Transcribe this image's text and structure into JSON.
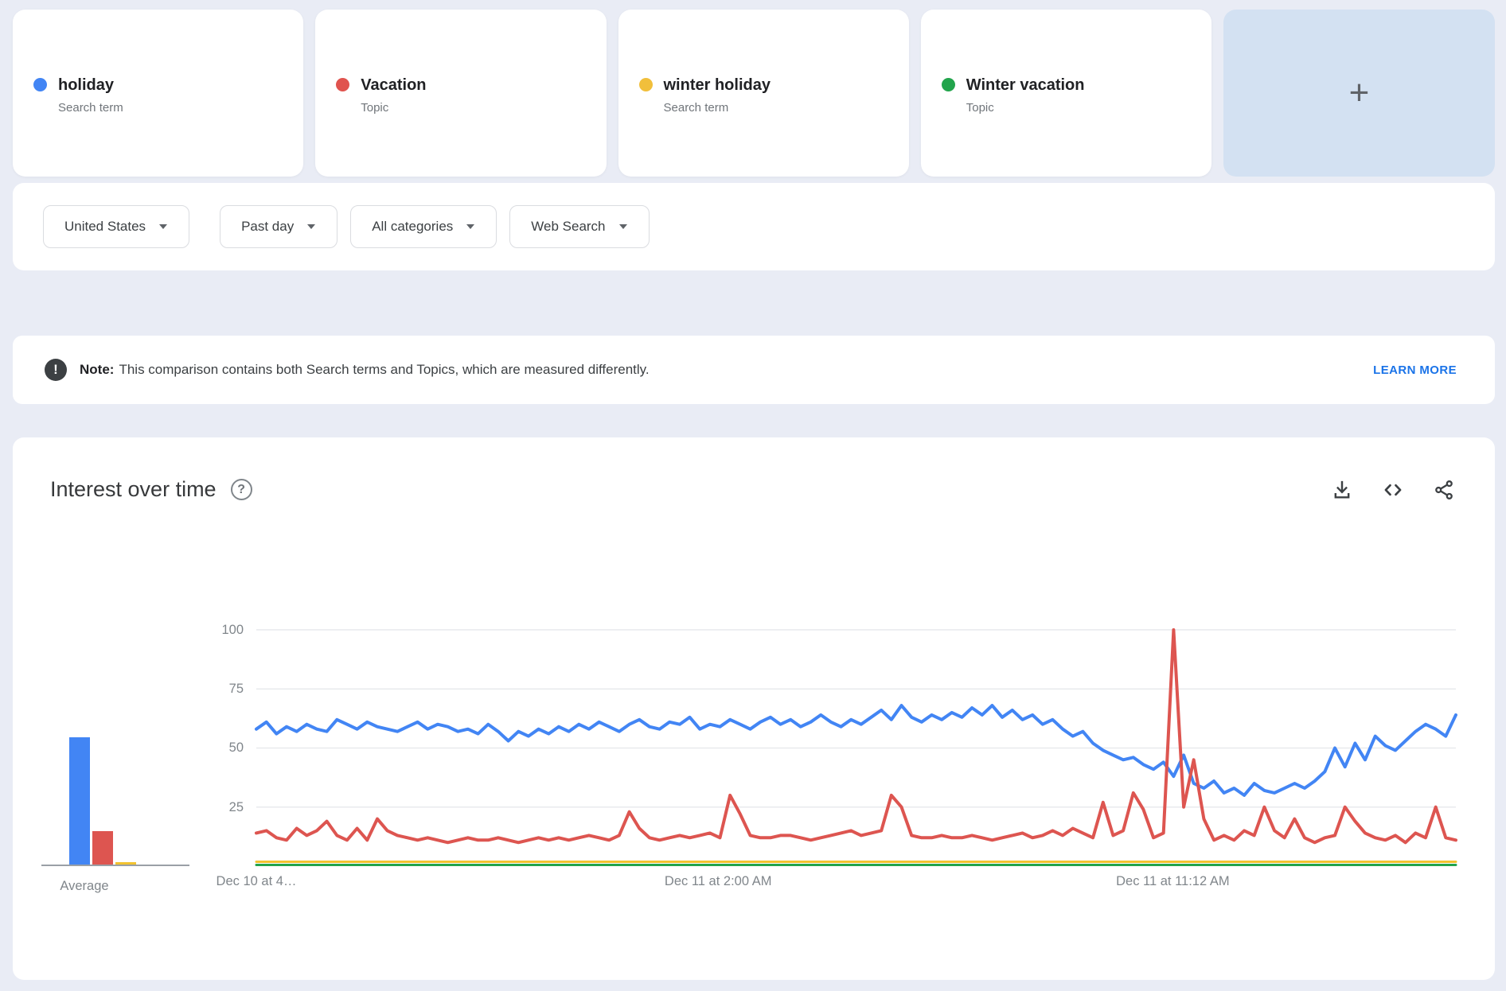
{
  "terms": [
    {
      "label": "holiday",
      "type": "Search term",
      "color": "#4285f4"
    },
    {
      "label": "Vacation",
      "type": "Topic",
      "color": "#e0534e"
    },
    {
      "label": "winter holiday",
      "type": "Search term",
      "color": "#f1bf3b"
    },
    {
      "label": "Winter vacation",
      "type": "Topic",
      "color": "#22a44c"
    }
  ],
  "add_term": {
    "label": "+"
  },
  "filters": [
    {
      "label": "United States"
    },
    {
      "label": "Past day"
    },
    {
      "label": "All categories"
    },
    {
      "label": "Web Search"
    }
  ],
  "note": {
    "prefix": "Note:",
    "text": "This comparison contains both Search terms and Topics, which are measured differently.",
    "action_label": "LEARN MORE"
  },
  "interest_section": {
    "title": "Interest over time",
    "help_glyph": "?",
    "note_icon_glyph": "!"
  },
  "chart_data": {
    "type": "line",
    "title": "Interest over time",
    "x_axis": {
      "labels": [
        {
          "text": "Dec 10 at 4…",
          "pos": 0.0
        },
        {
          "text": "Dec 11 at 2:00 AM",
          "pos": 0.385
        },
        {
          "text": "Dec 11 at 11:12 AM",
          "pos": 0.764
        }
      ]
    },
    "y_axis": {
      "ticks": [
        25,
        50,
        75,
        100
      ],
      "range": [
        0,
        100
      ],
      "grid": true
    },
    "legend_position": "none",
    "average_bars": {
      "label": "Average",
      "values": [
        {
          "name": "holiday",
          "value": 54
        },
        {
          "name": "Vacation",
          "value": 14
        },
        {
          "name": "winter holiday",
          "value": 1
        },
        {
          "name": "Winter vacation",
          "value": 0
        }
      ]
    },
    "series": [
      {
        "name": "holiday",
        "color": "#4285f4",
        "stroke_width": 4,
        "values": [
          58,
          61,
          56,
          59,
          57,
          60,
          58,
          57,
          62,
          60,
          58,
          61,
          59,
          58,
          57,
          59,
          61,
          58,
          60,
          59,
          57,
          58,
          56,
          60,
          57,
          53,
          57,
          55,
          58,
          56,
          59,
          57,
          60,
          58,
          61,
          59,
          57,
          60,
          62,
          59,
          58,
          61,
          60,
          63,
          58,
          60,
          59,
          62,
          60,
          58,
          61,
          63,
          60,
          62,
          59,
          61,
          64,
          61,
          59,
          62,
          60,
          63,
          66,
          62,
          68,
          63,
          61,
          64,
          62,
          65,
          63,
          67,
          64,
          68,
          63,
          66,
          62,
          64,
          60,
          62,
          58,
          55,
          57,
          52,
          49,
          47,
          45,
          46,
          43,
          41,
          44,
          38,
          47,
          35,
          33,
          36,
          31,
          33,
          30,
          35,
          32,
          31,
          33,
          35,
          33,
          36,
          40,
          50,
          42,
          52,
          45,
          55,
          51,
          49,
          53,
          57,
          60,
          58,
          55,
          64
        ]
      },
      {
        "name": "Vacation",
        "color": "#dd5550",
        "stroke_width": 4,
        "values": [
          14,
          15,
          12,
          11,
          16,
          13,
          15,
          19,
          13,
          11,
          16,
          11,
          20,
          15,
          13,
          12,
          11,
          12,
          11,
          10,
          11,
          12,
          11,
          11,
          12,
          11,
          10,
          11,
          12,
          11,
          12,
          11,
          12,
          13,
          12,
          11,
          13,
          23,
          16,
          12,
          11,
          12,
          13,
          12,
          13,
          14,
          12,
          30,
          22,
          13,
          12,
          12,
          13,
          13,
          12,
          11,
          12,
          13,
          14,
          15,
          13,
          14,
          15,
          30,
          25,
          13,
          12,
          12,
          13,
          12,
          12,
          13,
          12,
          11,
          12,
          13,
          14,
          12,
          13,
          15,
          13,
          16,
          14,
          12,
          27,
          13,
          15,
          31,
          24,
          12,
          14,
          100,
          25,
          45,
          20,
          11,
          13,
          11,
          15,
          13,
          25,
          15,
          12,
          20,
          12,
          10,
          12,
          13,
          25,
          19,
          14,
          12,
          11,
          13,
          10,
          14,
          12,
          25,
          12,
          11
        ]
      },
      {
        "name": "winter holiday",
        "color": "#f2c230",
        "stroke_width": 3,
        "y_offset": -2.5,
        "values": [
          1,
          1,
          1,
          1,
          1,
          1,
          1,
          1,
          1,
          1,
          1,
          1,
          1,
          1,
          1,
          1,
          1,
          1,
          1,
          1,
          1,
          1,
          1,
          1,
          1,
          1,
          1,
          1,
          1,
          1,
          1,
          1,
          1,
          1,
          1,
          1,
          1,
          1,
          1,
          1,
          1,
          1,
          1,
          1,
          1,
          1,
          1,
          1,
          1,
          1,
          1,
          1,
          1,
          1,
          1,
          1,
          1,
          1,
          1,
          1,
          1,
          1,
          1,
          1,
          1,
          1,
          1,
          1,
          1,
          1,
          1,
          1,
          1,
          1,
          1,
          1,
          1,
          1,
          1,
          1,
          1,
          1,
          1,
          1,
          1,
          1,
          1,
          1,
          1,
          1,
          1,
          1,
          1,
          1,
          1,
          1,
          1,
          1,
          1,
          1,
          1,
          1,
          1,
          1,
          1,
          1,
          1,
          1,
          1,
          1,
          1,
          1,
          1,
          1,
          1,
          1,
          1,
          1,
          1,
          1
        ]
      },
      {
        "name": "Winter vacation",
        "color": "#22a44c",
        "stroke_width": 3,
        "y_offset": -1.5,
        "values": [
          0,
          0,
          0,
          0,
          0,
          0,
          0,
          0,
          0,
          0,
          0,
          0,
          0,
          0,
          0,
          0,
          0,
          0,
          0,
          0,
          0,
          0,
          0,
          0,
          0,
          0,
          0,
          0,
          0,
          0,
          0,
          0,
          0,
          0,
          0,
          0,
          0,
          0,
          0,
          0,
          0,
          0,
          0,
          0,
          0,
          0,
          0,
          0,
          0,
          0,
          0,
          0,
          0,
          0,
          0,
          0,
          0,
          0,
          0,
          0,
          0,
          0,
          0,
          0,
          0,
          0,
          0,
          0,
          0,
          0,
          0,
          0,
          0,
          0,
          0,
          0,
          0,
          0,
          0,
          0,
          0,
          0,
          0,
          0,
          0,
          0,
          0,
          0,
          0,
          0,
          0,
          0,
          0,
          0,
          0,
          0,
          0,
          0,
          0,
          0,
          0,
          0,
          0,
          0,
          0,
          0,
          0,
          0,
          0,
          0,
          0,
          0,
          0,
          0,
          0,
          0,
          0,
          0,
          0,
          0
        ]
      }
    ]
  }
}
